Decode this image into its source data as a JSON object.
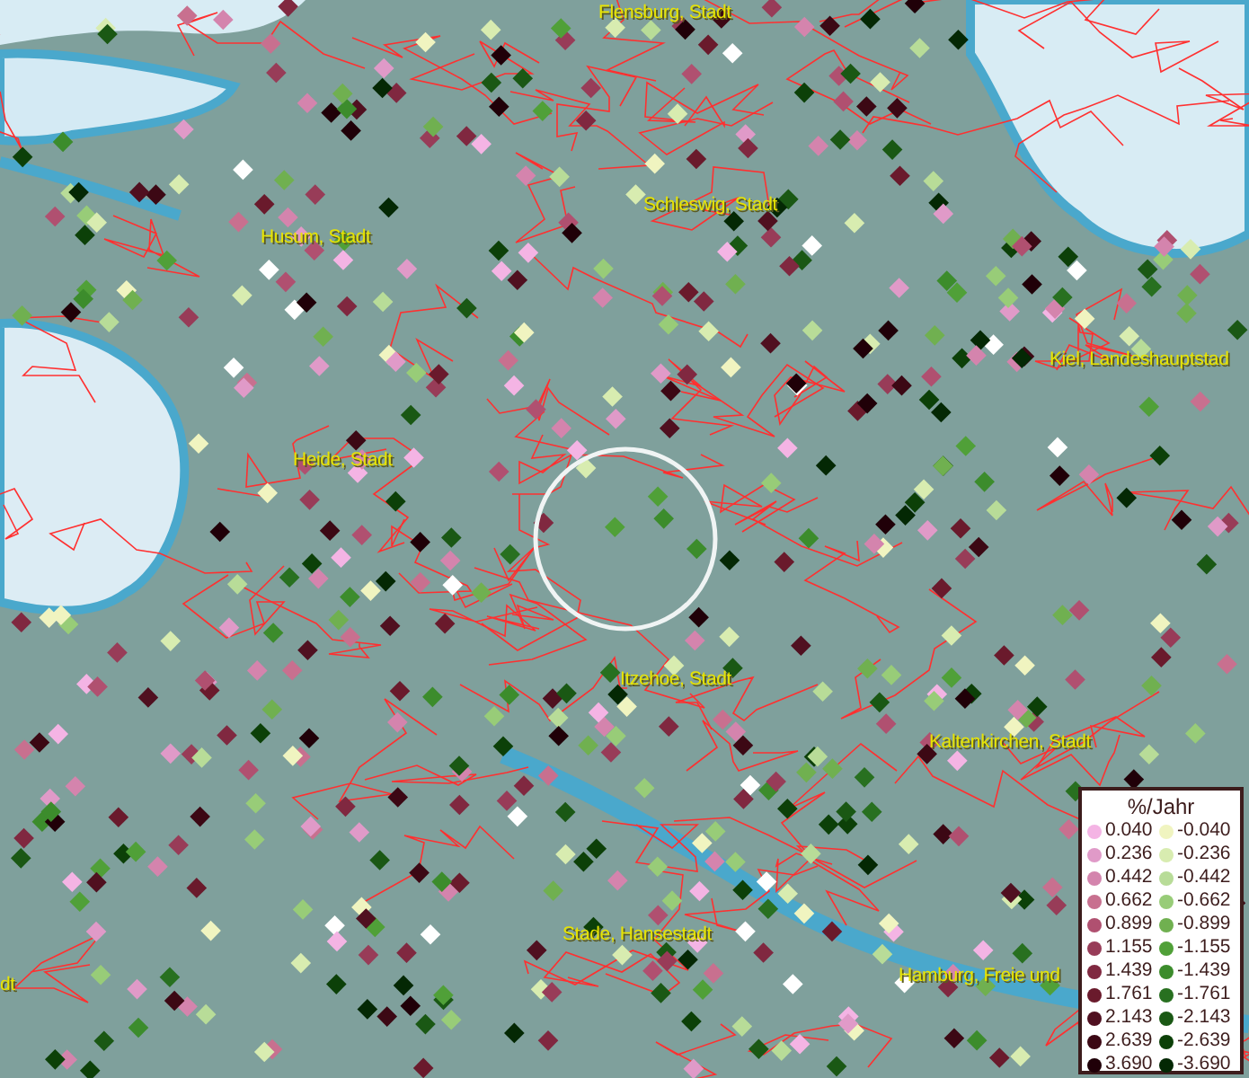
{
  "map": {
    "places": [
      {
        "name": "Flensburg, Stadt"
      },
      {
        "name": "Husum, Stadt"
      },
      {
        "name": "Schleswig, Stadt"
      },
      {
        "name": "Kiel, Landeshauptstad"
      },
      {
        "name": "Heide, Stadt"
      },
      {
        "name": "Itzehoe, Stadt"
      },
      {
        "name": "Kaltenkirchen, Stadt"
      },
      {
        "name": "Stade, Hansestadt"
      },
      {
        "name": "dt"
      },
      {
        "name": "Hamburg, Freie und"
      }
    ]
  },
  "legend": {
    "title": "%/Jahr",
    "items": [
      {
        "label": "0.040",
        "color": "#f4b4e4"
      },
      {
        "label": "-0.040",
        "color": "#f0f4c0"
      },
      {
        "label": "0.236",
        "color": "#e09ac8"
      },
      {
        "label": "-0.236",
        "color": "#d8ecb0"
      },
      {
        "label": "0.442",
        "color": "#d484ad"
      },
      {
        "label": "-0.442",
        "color": "#b8dc98"
      },
      {
        "label": "0.662",
        "color": "#c8708f"
      },
      {
        "label": "-0.662",
        "color": "#98cc78"
      },
      {
        "label": "0.899",
        "color": "#b05070"
      },
      {
        "label": "-0.899",
        "color": "#70b050"
      },
      {
        "label": "1.155",
        "color": "#983c58"
      },
      {
        "label": "-1.155",
        "color": "#50a038"
      },
      {
        "label": "1.439",
        "color": "#802840"
      },
      {
        "label": "-1.439",
        "color": "#3c8c2c"
      },
      {
        "label": "1.761",
        "color": "#6a1a2c"
      },
      {
        "label": "-1.761",
        "color": "#287020"
      },
      {
        "label": "2.143",
        "color": "#501020"
      },
      {
        "label": "-2.143",
        "color": "#1a5814"
      },
      {
        "label": "2.639",
        "color": "#3c0814"
      },
      {
        "label": "-2.639",
        "color": "#0c4008"
      },
      {
        "label": "3.690",
        "color": "#200008"
      },
      {
        "label": "-3.690",
        "color": "#042804"
      }
    ]
  }
}
